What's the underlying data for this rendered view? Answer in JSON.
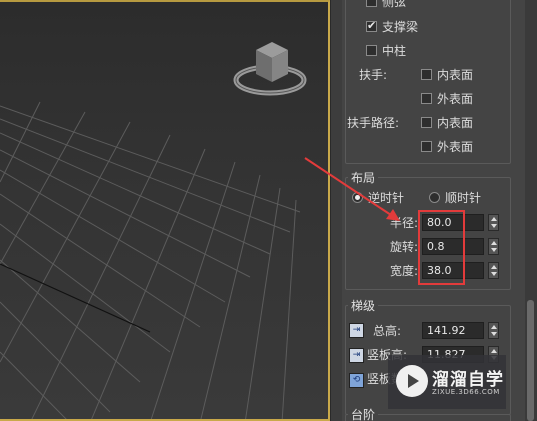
{
  "railing_options": {
    "side_string_label": "侧弦",
    "side_string_checked": false,
    "carriage_label": "支撑梁",
    "carriage_checked": true,
    "center_pole_label": "中柱",
    "center_pole_checked": false,
    "handrail_label": "扶手:",
    "handrail_inner_label": "内表面",
    "handrail_outer_label": "外表面",
    "rail_path_label": "扶手路径:",
    "rail_path_inner_label": "内表面",
    "rail_path_outer_label": "外表面"
  },
  "layout_group": {
    "title": "布局",
    "ccw_label": "逆时针",
    "cw_label": "顺时针",
    "selected_direction": "ccw",
    "radius_label": "半径:",
    "radius_value": "80.0",
    "revs_label": "旋转:",
    "revs_value": "0.8",
    "width_label": "宽度:",
    "width_value": "38.0"
  },
  "rise_group": {
    "title": "梯级",
    "overall_label": "总高:",
    "overall_value": "141.92",
    "riser_ht_label": "竖板高:",
    "riser_ht_value": "11.827",
    "riser_ct_label": "竖板数:"
  },
  "steps_group": {
    "title": "台阶"
  },
  "watermark": {
    "name": "溜溜自学",
    "url": "ZIXUE.3D66.COM"
  },
  "colors": {
    "viewport_border": "#c9a94a",
    "highlight": "#e33b3b",
    "panel_bg": "#444444"
  }
}
